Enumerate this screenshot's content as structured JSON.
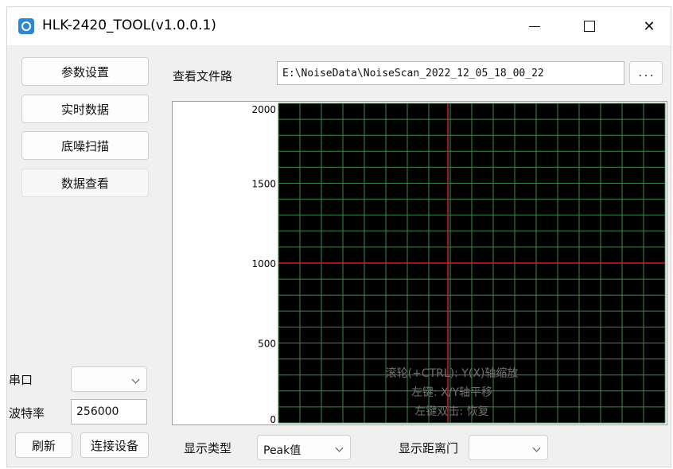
{
  "window": {
    "title": "HLK-2420_TOOL(v1.0.0.1)"
  },
  "sidebar": {
    "items": [
      {
        "label": "参数设置"
      },
      {
        "label": "实时数据"
      },
      {
        "label": "底噪扫描"
      },
      {
        "label": "数据查看"
      }
    ],
    "serial_label": "串口",
    "serial_value": "",
    "baud_label": "波特率",
    "baud_value": "256000",
    "refresh_label": "刷新",
    "connect_label": "连接设备"
  },
  "file": {
    "label": "查看文件路",
    "path": "E:\\NoiseData\\NoiseScan_2022_12_05_18_00_22",
    "browse_label": "..."
  },
  "chart_data": {
    "type": "line",
    "y_ticks": [
      "2000",
      "1500",
      "1000",
      "500",
      "0"
    ],
    "ylim": [
      0,
      2000
    ],
    "grid": true,
    "background": "#000000",
    "grid_color": "#3d8a4d",
    "cursor_color": "#d02020",
    "cursor_y": 1000,
    "hints": [
      "滚轮(+CTRL): Y(X)轴缩放",
      "左键: X/Y轴平移",
      "左键双击: 恢复"
    ]
  },
  "bottom": {
    "display_type_label": "显示类型",
    "display_type_value": "Peak值",
    "distance_gate_label": "显示距离门",
    "distance_gate_value": ""
  }
}
